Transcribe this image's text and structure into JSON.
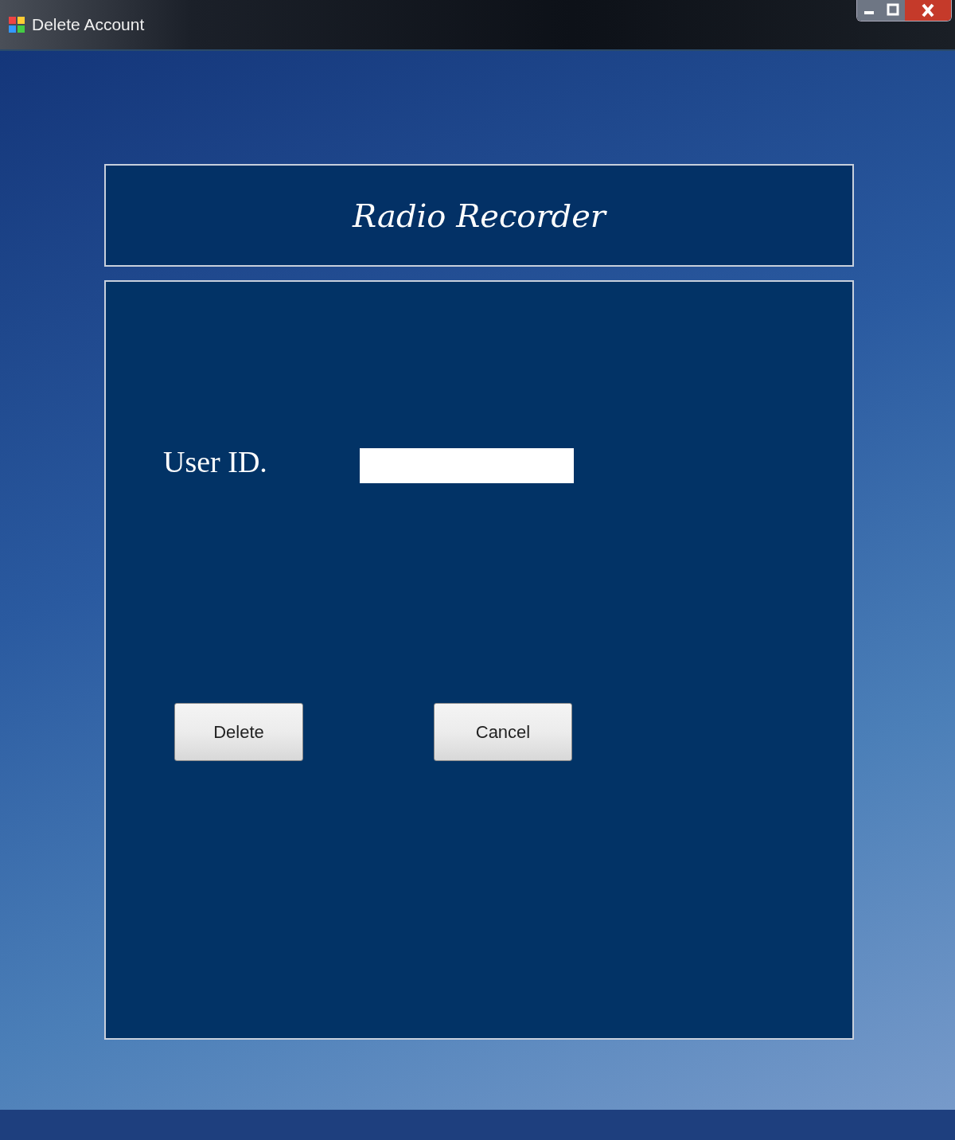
{
  "window": {
    "title": "Delete Account"
  },
  "header": {
    "title": "Radio Recorder"
  },
  "form": {
    "fields": [
      {
        "label": "User ID."
      }
    ]
  },
  "buttons": [
    {
      "label": "Delete"
    },
    {
      "label": "Cancel"
    }
  ]
}
